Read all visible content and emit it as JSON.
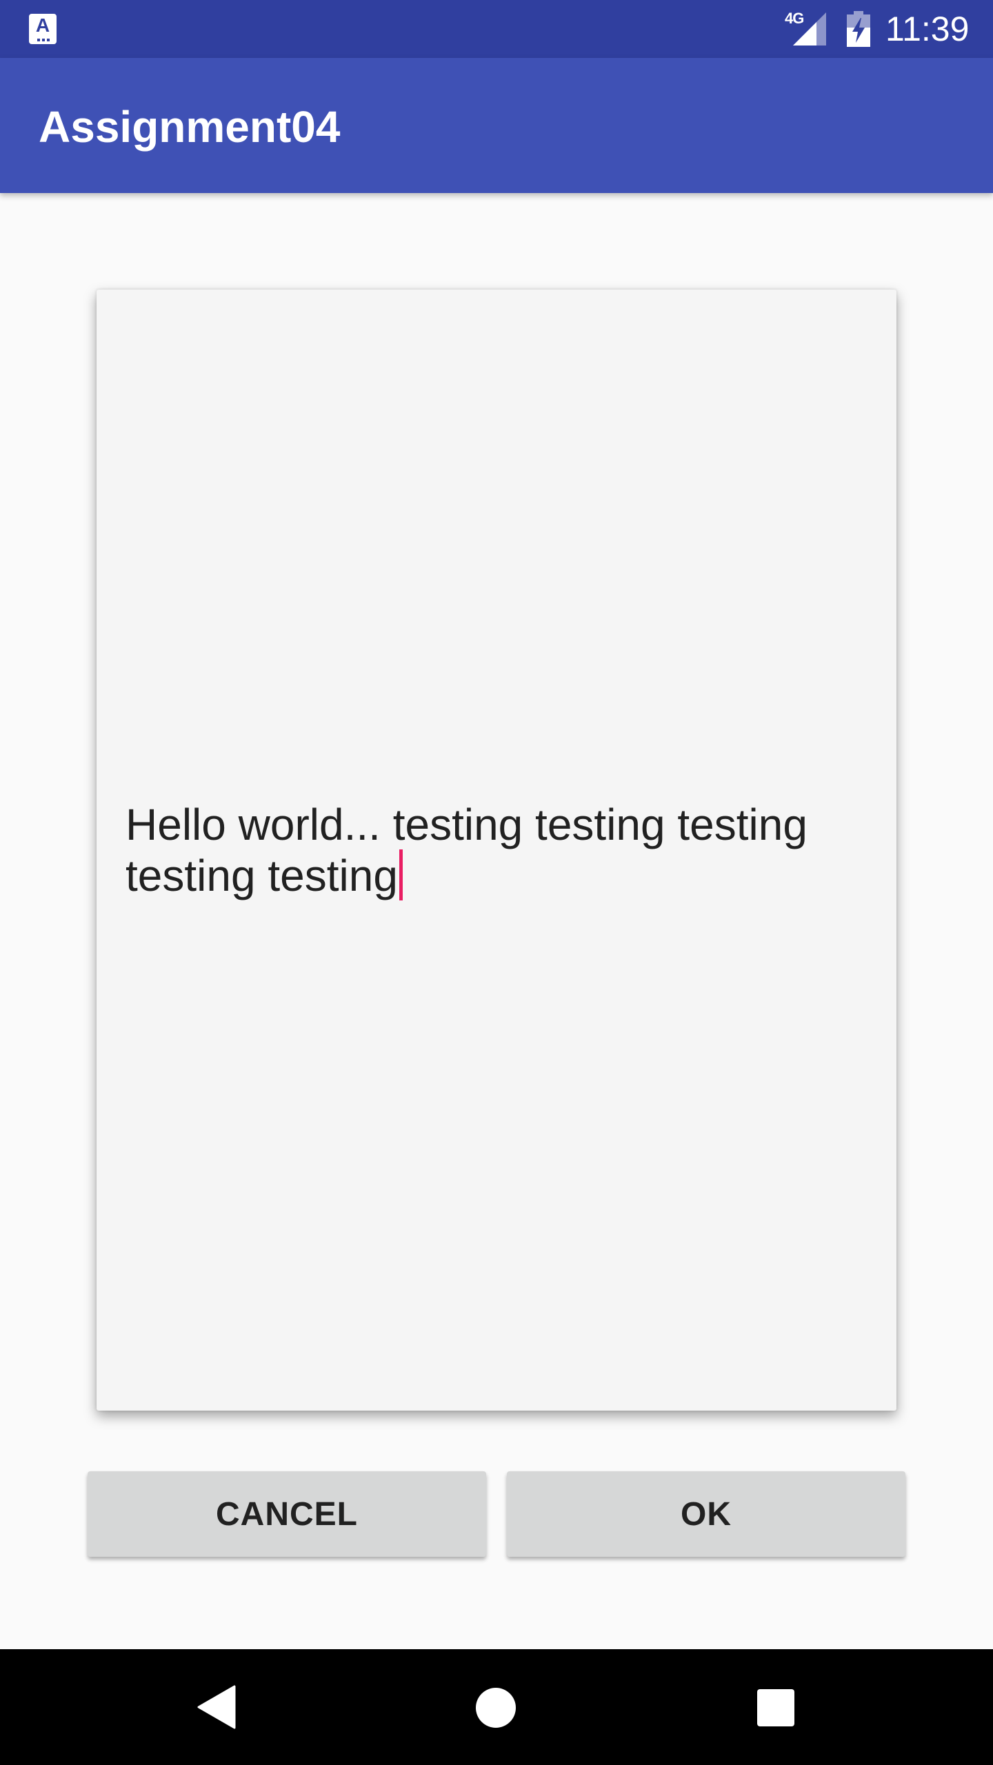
{
  "status_bar": {
    "network_label": "4G",
    "time": "11:39",
    "app_icon_letter": "A"
  },
  "app_bar": {
    "title": "Assignment04"
  },
  "editor": {
    "text": "Hello world... testing testing testing testing testing",
    "cursor_color": "#e91e63"
  },
  "buttons": {
    "cancel_label": "CANCEL",
    "ok_label": "OK"
  },
  "colors": {
    "primary": "#3f51b5",
    "primary_dark": "#303f9f",
    "accent": "#e91e63"
  },
  "nav_bar": {
    "icons": [
      "back-icon",
      "home-icon",
      "recents-icon"
    ]
  }
}
